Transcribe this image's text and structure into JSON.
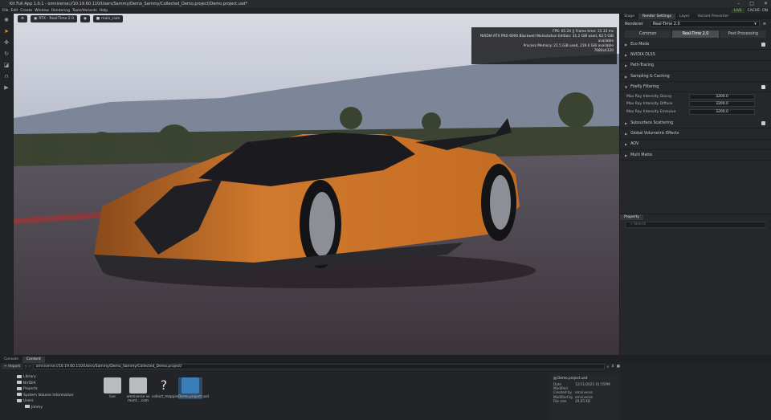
{
  "window": {
    "title": "Kit Full App 1.0.1 - omniverse://10.19.60.110/Users/Sammy/Demo_Sammy/Collected_Demo.project/Demo.project.usd*",
    "controls": [
      "–",
      "□",
      "✕"
    ]
  },
  "menu": {
    "items": [
      "File",
      "Edit",
      "Create",
      "Window",
      "Rendering",
      "Tools/Variants",
      "Help"
    ],
    "live_label": "LIVE",
    "cache_label": "CACHE: ON"
  },
  "viewport": {
    "renderer_chip": "RTX - Real-Time 2.0",
    "camera_chip": "main_cam",
    "stats": [
      "FPS: 65.24 || Frame time: 15.33 ms",
      "NVIDIA RTX PRO 6000 Blackwell Workstation Edition: 31.1 GiB used, 62.5 GiB available",
      "Process Memory: 21.5 GiB used, 219.0 GiB available",
      "7680x4320"
    ]
  },
  "render_panel": {
    "tabs": [
      "Stage",
      "Render Settings",
      "Layer",
      "Variant Presenter"
    ],
    "selected_tab": "Render Settings",
    "renderer_label": "Renderer",
    "renderer_value": "Real-Time 2.0",
    "subtabs": [
      "Common",
      "Real-Time 2.0",
      "Post Processing"
    ],
    "sections_top": [
      {
        "label": "Eco Mode",
        "checkbox": true
      },
      {
        "label": "NVIDIA DLSS",
        "checkbox": false
      },
      {
        "label": "Path-Tracing",
        "checkbox": false
      },
      {
        "label": "Sampling & Caching",
        "checkbox": false
      }
    ],
    "firefly": {
      "label": "Firefly Filtering",
      "checked": true,
      "rows": [
        {
          "label": "Max Ray Intensity Glossy",
          "value": "3200.0"
        },
        {
          "label": "Max Ray Intensity Diffuse",
          "value": "3200.0"
        },
        {
          "label": "Max Ray Intensity Emissive",
          "value": "3200.0"
        }
      ]
    },
    "sections_bottom": [
      {
        "label": "Subsurface Scattering",
        "checkbox": true
      },
      {
        "label": "Global Volumetric Effects",
        "checkbox": false
      },
      {
        "label": "AOV",
        "checkbox": false
      },
      {
        "label": "Multi Matte",
        "checkbox": false
      }
    ]
  },
  "property_panel": {
    "tab": "Property",
    "search_placeholder": "Search"
  },
  "bottom": {
    "tabs": [
      "Console",
      "Content"
    ],
    "selected_tab": "Content",
    "import_label": "Import",
    "path": "omniverse://10.19.60.110/Users/Sammy/Demo_Sammy/Collected_Demo.project/",
    "tree": [
      "Library",
      "NVIDIA",
      "Projects",
      "System Volume Information",
      "Users",
      "Jimmy"
    ],
    "grid": [
      {
        "label": "live",
        "selected": false
      },
      {
        "label": "omniverse vs mont....com",
        "selected": false
      },
      {
        "label": "collect_mapping.json",
        "selected": false
      },
      {
        "label": "Demo.project.usd",
        "selected": true
      }
    ],
    "info": {
      "filename": "Demo.project.usd",
      "rows": [
        {
          "k": "Date Modified",
          "v": "12/11/2025 01:55PM"
        },
        {
          "k": "Created by",
          "v": "omniverse"
        },
        {
          "k": "Modified by",
          "v": "omniverse"
        },
        {
          "k": "File size",
          "v": "29.65 KB"
        }
      ]
    }
  }
}
